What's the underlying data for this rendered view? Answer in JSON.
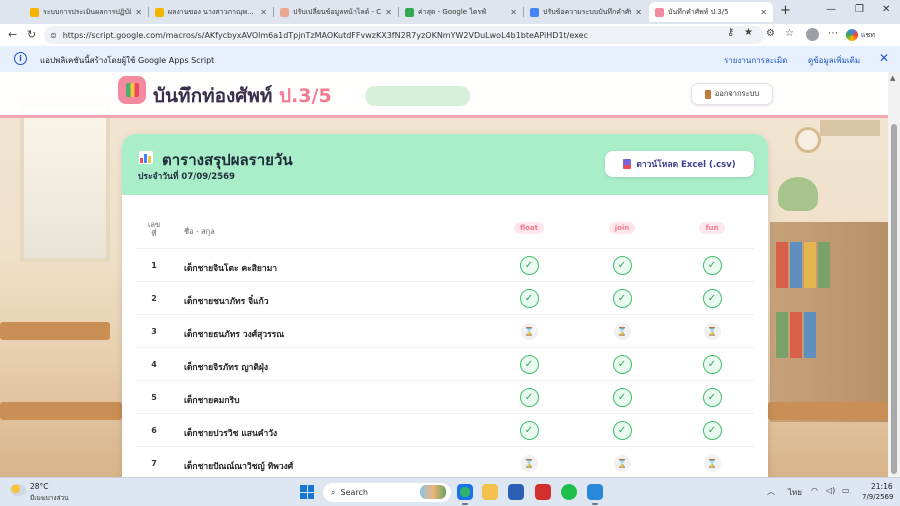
{
  "browser": {
    "tabs": [
      {
        "title": "ระบบการประเมินผลการปฏิบัติงานฯ",
        "favicon_color": "#f4b400",
        "active": false
      },
      {
        "title": "ผลงานของ นางสาวภาณุพ...",
        "favicon_color": "#f4b400",
        "active": false
      },
      {
        "title": "ปรับเปลี่ยนข้อมูลหน้าไลด์ - Cl...",
        "favicon_color": "#e8a892",
        "active": false
      },
      {
        "title": "ค่าสุด - Google ไดรฟ์",
        "favicon_color": "#34a853",
        "active": false
      },
      {
        "title": "ปรับข้อความระบบบันทึกคำศัพท์...",
        "favicon_color": "#4285f4",
        "active": false
      },
      {
        "title": "บันทึกคำศัพท์ ป.3/5",
        "favicon_color": "#f48aa0",
        "active": true
      }
    ],
    "url": "https://script.google.com/macros/s/AKfycbyxAVOlm6a1dTpjnTzMAOKutdFFvwzKX3fN2R7yzOKNmYW2VDuLwoL4b1bteAPiHD1t/exec",
    "infobar": {
      "message": "แอปพลิเคชันนี้สร้างโดยผู้ใช้ Google Apps Script",
      "report_link": "รายงานการละเมิด",
      "details_link": "ดูข้อมูลเพิ่มเติม"
    },
    "profile_label": "แชท"
  },
  "app": {
    "title": "บันทึกท่องศัพท์",
    "class_label": "ป.3/5",
    "logout_label": "ออกจากระบบ"
  },
  "summary": {
    "title": "ตารางสรุปผลรายวัน",
    "date_label": "ประจำวันที่ 07/09/2569",
    "download_label": "ดาวน์โหลด Excel (.csv)",
    "columns": {
      "number": "เลขที่",
      "name": "ชื่อ - สกุล",
      "words": [
        "float",
        "join",
        "fun"
      ]
    },
    "rows": [
      {
        "no": "1",
        "name": "เด็กชายจินโตะ คะสิยามา",
        "status": [
          "done",
          "done",
          "done"
        ]
      },
      {
        "no": "2",
        "name": "เด็กชายชนาภัทร จิ๋แก้ว",
        "status": [
          "done",
          "done",
          "done"
        ]
      },
      {
        "no": "3",
        "name": "เด็กชายธนภัทร วงศ์สุวรรณ",
        "status": [
          "pending",
          "pending",
          "pending"
        ]
      },
      {
        "no": "4",
        "name": "เด็กชายจิรภัทร ญาติฝุ่ง",
        "status": [
          "done",
          "done",
          "done"
        ]
      },
      {
        "no": "5",
        "name": "เด็กชายคมกริบ",
        "status": [
          "done",
          "done",
          "done"
        ]
      },
      {
        "no": "6",
        "name": "เด็กชายปวรวิช แสนคำวัง",
        "status": [
          "done",
          "done",
          "done"
        ]
      },
      {
        "no": "7",
        "name": "เด็กชายปัณณ์ณาวิชญ์ ทิพวงศ์",
        "status": [
          "pending",
          "pending",
          "pending"
        ]
      }
    ],
    "status_colors": {
      "done": "#3fbf6b",
      "pending": "#c49a3a"
    }
  },
  "taskbar": {
    "weather_temp": "28°C",
    "weather_desc": "มีเมฆบางส่วน",
    "search_placeholder": "Search",
    "lang": "ไทย",
    "time": "21:16",
    "date": "7/9/2569"
  }
}
